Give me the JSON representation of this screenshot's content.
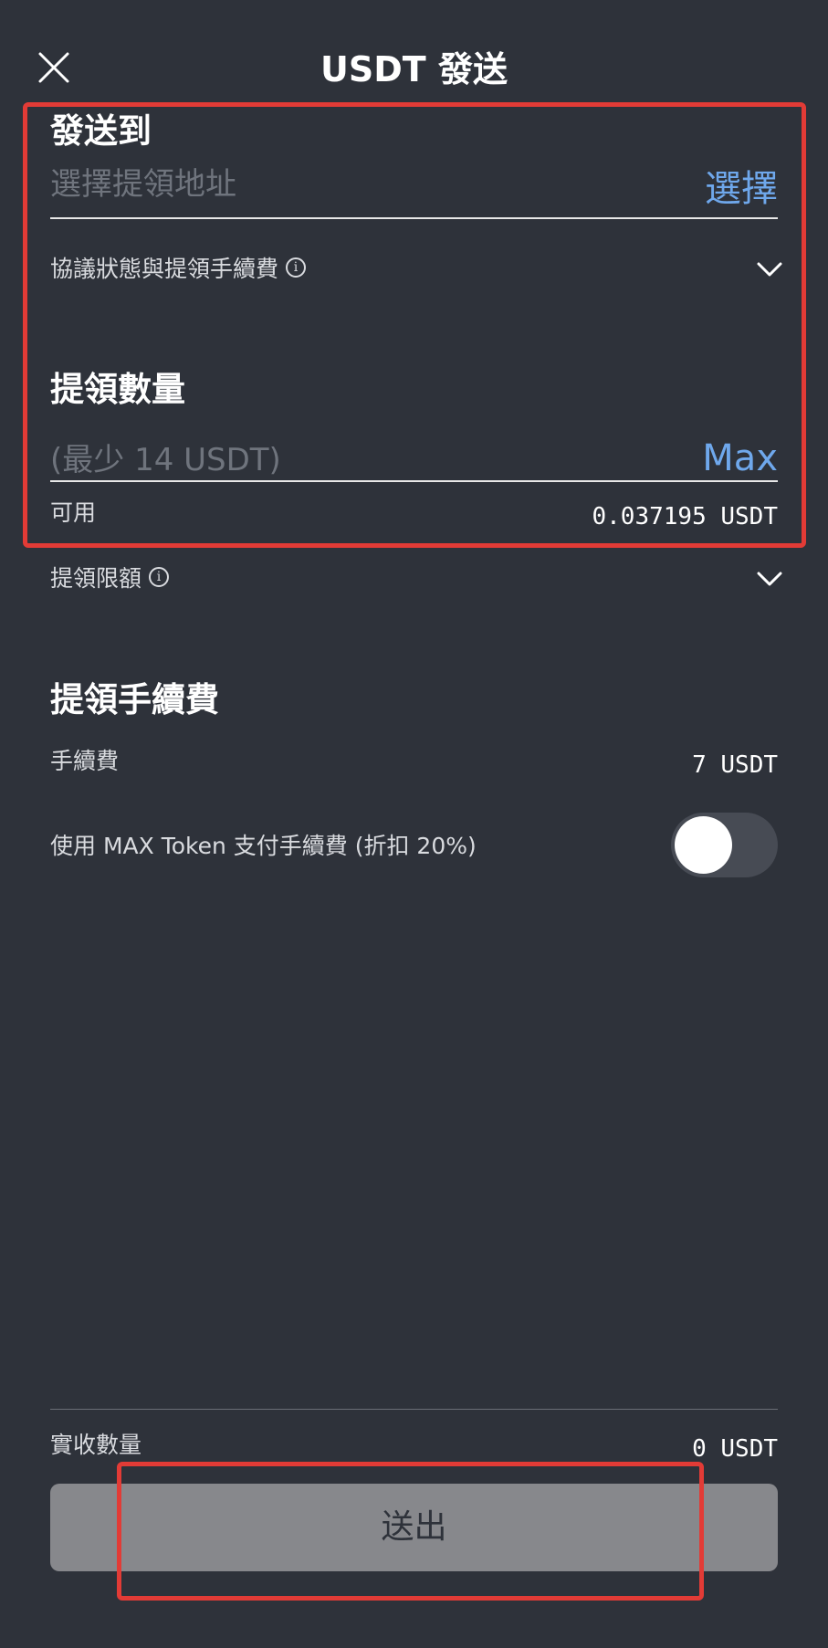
{
  "header": {
    "title": "USDT 發送",
    "close_icon": "close-icon"
  },
  "send_to": {
    "title": "發送到",
    "placeholder": "選擇提領地址",
    "action_label": "選擇"
  },
  "protocol": {
    "label": "協議狀態與提領手續費",
    "info_icon": "info-icon",
    "expand_icon": "chevron-down-icon"
  },
  "amount": {
    "title": "提領數量",
    "placeholder": "(最少 14 USDT)",
    "max_label": "Max",
    "available_label": "可用",
    "available_value": "0.037195 USDT"
  },
  "limit": {
    "label": "提領限額",
    "info_icon": "info-icon",
    "expand_icon": "chevron-down-icon"
  },
  "fee": {
    "title": "提領手續費",
    "fee_label": "手續費",
    "fee_value": "7 USDT",
    "max_token_label": "使用 MAX Token 支付手續費 (折扣 20%)",
    "max_token_enabled": false
  },
  "footer": {
    "received_label": "實收數量",
    "received_value": "0 USDT",
    "submit_label": "送出"
  },
  "colors": {
    "background": "#2e323a",
    "accent": "#6fa8ec",
    "highlight_frame": "#e23b36",
    "button_disabled": "#87888c"
  }
}
